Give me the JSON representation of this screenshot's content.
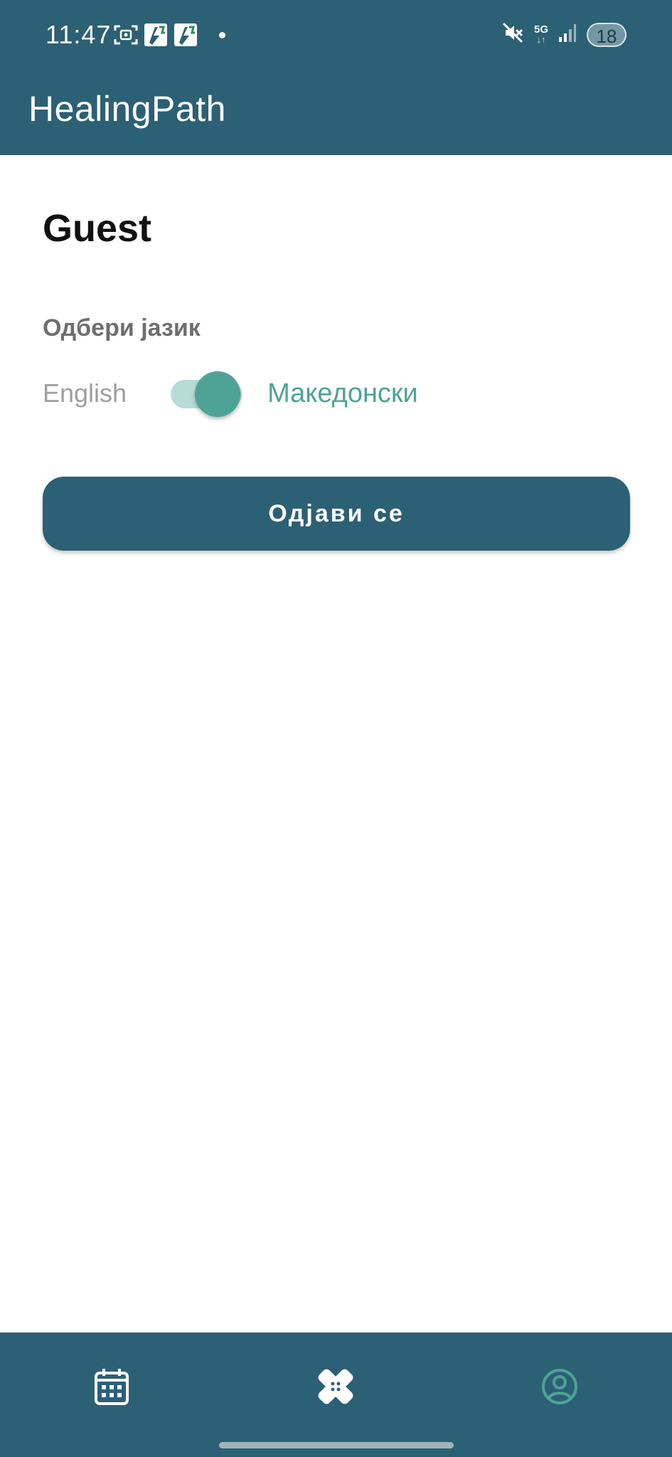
{
  "status_bar": {
    "time": "11:47",
    "network": "5G",
    "battery": "18",
    "icons_left": [
      "screenshot-icon",
      "app-notification-icon",
      "app-notification-icon",
      "notification-dot"
    ],
    "icons_right": [
      "mute-icon",
      "5g-data-icon",
      "signal-icon",
      "battery-icon"
    ]
  },
  "app_bar": {
    "title": "HealingPath"
  },
  "profile": {
    "user_name": "Guest",
    "language_heading": "Одбери јазик",
    "language_option_left": "English",
    "language_option_right": "Македонски",
    "language_toggle_on": true,
    "logout_label": "Одјави се"
  },
  "bottom_nav": {
    "items": [
      {
        "icon": "calendar-icon",
        "active": false
      },
      {
        "icon": "bandage-icon",
        "active": false
      },
      {
        "icon": "profile-icon",
        "active": true
      }
    ]
  },
  "colors": {
    "primary": "#2c6075",
    "accent": "#4ea396",
    "accent_track": "#b7dcd8",
    "muted_text": "#9e9e9e",
    "heading_text": "#6e6e6e"
  }
}
